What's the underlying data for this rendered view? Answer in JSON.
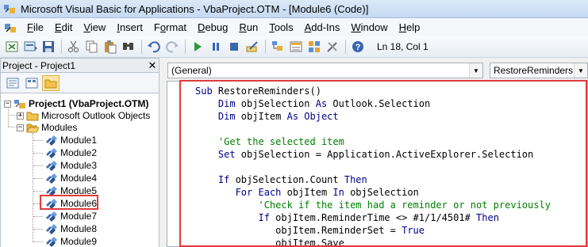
{
  "window": {
    "title": "Microsoft Visual Basic for Applications - VbaProject.OTM - [Module6 (Code)]"
  },
  "menu": {
    "items": [
      "File",
      "Edit",
      "View",
      "Insert",
      "Format",
      "Debug",
      "Run",
      "Tools",
      "Add-Ins",
      "Window",
      "Help"
    ],
    "underline": [
      "F",
      "E",
      "V",
      "I",
      "o",
      "D",
      "R",
      "T",
      "A",
      "W",
      "H"
    ]
  },
  "toolbar": {
    "status": "Ln 18, Col 1",
    "icons": [
      "vba-icon",
      "view-excel-icon",
      "insert-module-icon",
      "save-icon",
      "cut-icon",
      "copy-icon",
      "paste-icon",
      "find-icon",
      "undo-icon",
      "redo-icon",
      "run-icon",
      "break-icon",
      "reset-icon",
      "design-mode-icon",
      "project-explorer-icon",
      "properties-icon",
      "object-browser-icon",
      "toolbox-icon",
      "help-icon"
    ]
  },
  "project": {
    "header": "Project - Project1",
    "tree": {
      "root": "Project1 (VbaProject.OTM)",
      "outlook_objects": "Microsoft Outlook Objects",
      "modules_folder": "Modules",
      "modules": [
        "Module1",
        "Module2",
        "Module3",
        "Module4",
        "Module5",
        "Module6",
        "Module7",
        "Module8",
        "Module9"
      ]
    }
  },
  "code": {
    "object_combo": "(General)",
    "procedure_combo": "RestoreReminders",
    "lines": [
      {
        "parts": [
          {
            "t": "Sub ",
            "c": "kw"
          },
          {
            "t": "RestoreReminders()",
            "c": "tx"
          }
        ]
      },
      {
        "parts": [
          {
            "t": "    Dim ",
            "c": "kw"
          },
          {
            "t": "objSelection ",
            "c": "tx"
          },
          {
            "t": "As ",
            "c": "kw"
          },
          {
            "t": "Outlook.Selection",
            "c": "tx"
          }
        ]
      },
      {
        "parts": [
          {
            "t": "    Dim ",
            "c": "kw"
          },
          {
            "t": "objItem ",
            "c": "tx"
          },
          {
            "t": "As Object",
            "c": "kw"
          }
        ]
      },
      {
        "parts": []
      },
      {
        "parts": [
          {
            "t": "    'Get the selected item",
            "c": "cm"
          }
        ]
      },
      {
        "parts": [
          {
            "t": "    Set ",
            "c": "kw"
          },
          {
            "t": "objSelection = Application.ActiveExplorer.Selection",
            "c": "tx"
          }
        ]
      },
      {
        "parts": []
      },
      {
        "parts": [
          {
            "t": "    If ",
            "c": "kw"
          },
          {
            "t": "objSelection.Count ",
            "c": "tx"
          },
          {
            "t": "Then",
            "c": "kw"
          }
        ]
      },
      {
        "parts": [
          {
            "t": "       For Each ",
            "c": "kw"
          },
          {
            "t": "objItem ",
            "c": "tx"
          },
          {
            "t": "In ",
            "c": "kw"
          },
          {
            "t": "objSelection",
            "c": "tx"
          }
        ]
      },
      {
        "parts": [
          {
            "t": "           'Check if the item had a reminder or not previously",
            "c": "cm"
          }
        ]
      },
      {
        "parts": [
          {
            "t": "           If ",
            "c": "kw"
          },
          {
            "t": "objItem.ReminderTime <> #1/1/4501# ",
            "c": "tx"
          },
          {
            "t": "Then",
            "c": "kw"
          }
        ]
      },
      {
        "parts": [
          {
            "t": "              objItem.ReminderSet = ",
            "c": "tx"
          },
          {
            "t": "True",
            "c": "kw"
          }
        ]
      },
      {
        "parts": [
          {
            "t": "              objItem.Save",
            "c": "tx"
          }
        ]
      }
    ]
  },
  "colors": {
    "keyword": "#00008b",
    "comment": "#008000",
    "highlight": "#e03c3c"
  }
}
